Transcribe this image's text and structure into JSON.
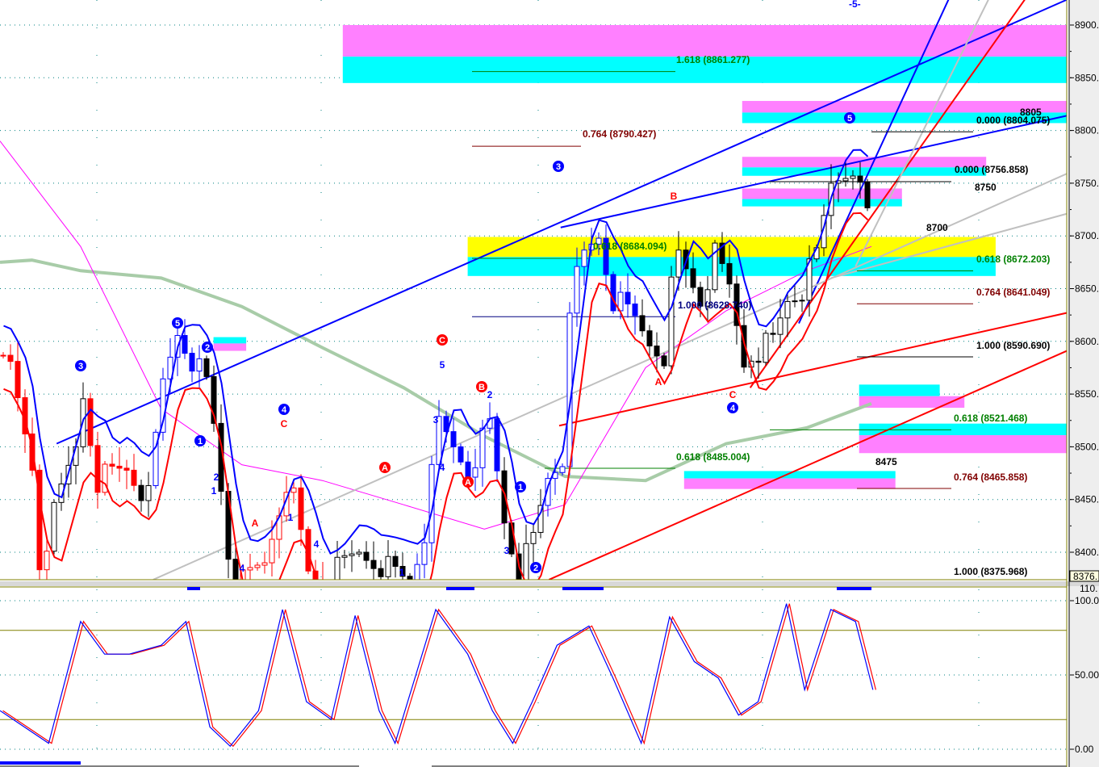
{
  "chart_data": {
    "type": "candlestick",
    "title": "",
    "top_marker": "-5-",
    "price_axis": {
      "ylim": [
        8350,
        8925
      ],
      "ticks": [
        "8900.",
        "8850.",
        "8800.",
        "8750.",
        "8700.",
        "8650.",
        "8600.",
        "8550.",
        "8500.",
        "8450.",
        "8400."
      ],
      "tick_values": [
        8900,
        8850,
        8800,
        8750,
        8700,
        8650,
        8600,
        8550,
        8500,
        8450,
        8400
      ],
      "last_price_label": "8376."
    },
    "oscillator_axis": {
      "ylim": [
        -8,
        110
      ],
      "ticks": [
        "100.0",
        "50.00",
        "0.00"
      ],
      "tick_values": [
        100,
        50,
        0
      ],
      "top_label": "110.",
      "levels": [
        80,
        20
      ]
    },
    "colors": {
      "up": "#ffffff",
      "down": "#000000",
      "blue": "#0000ff",
      "red": "#ff0000",
      "magenta": "#ff80ff",
      "cyan": "#00ffff",
      "yellow": "#ffff00",
      "ma": "#a8cca8",
      "grid": "#008080",
      "olive": "#808000"
    },
    "price_path": [
      [
        0,
        8600
      ],
      [
        4,
        8480
      ],
      [
        5,
        8390
      ],
      [
        10,
        8500
      ],
      [
        11,
        8550
      ],
      [
        13,
        8470
      ],
      [
        17,
        8480
      ],
      [
        20,
        8450
      ],
      [
        22,
        8560
      ],
      [
        24,
        8610
      ],
      [
        28,
        8560
      ],
      [
        29,
        8520
      ],
      [
        31,
        8400
      ],
      [
        33,
        8370
      ],
      [
        36,
        8390
      ],
      [
        39,
        8470
      ],
      [
        40,
        8450
      ],
      [
        42,
        8380
      ],
      [
        44,
        8370
      ],
      [
        49,
        8400
      ],
      [
        52,
        8390
      ],
      [
        56,
        8370
      ],
      [
        58,
        8420
      ],
      [
        60,
        8520
      ],
      [
        62,
        8500
      ],
      [
        64,
        8480
      ],
      [
        67,
        8520
      ],
      [
        69,
        8430
      ],
      [
        71,
        8380
      ],
      [
        73,
        8410
      ],
      [
        75,
        8470
      ],
      [
        77,
        8490
      ],
      [
        78,
        8640
      ],
      [
        80,
        8680
      ],
      [
        82,
        8700
      ],
      [
        84,
        8640
      ],
      [
        87,
        8620
      ],
      [
        89,
        8600
      ],
      [
        91,
        8590
      ],
      [
        92,
        8650
      ],
      [
        93,
        8680
      ],
      [
        96,
        8640
      ],
      [
        98,
        8680
      ],
      [
        100,
        8650
      ],
      [
        102,
        8580
      ],
      [
        103,
        8590
      ],
      [
        106,
        8600
      ],
      [
        108,
        8640
      ],
      [
        110,
        8650
      ],
      [
        112,
        8680
      ],
      [
        114,
        8750
      ],
      [
        117,
        8770
      ],
      [
        118,
        8740
      ],
      [
        119,
        8720
      ]
    ],
    "bar_color_regimes": [
      {
        "from": 0,
        "to": 6,
        "color": "red"
      },
      {
        "from": 12,
        "to": 18,
        "color": "red"
      },
      {
        "from": 21,
        "to": 27,
        "color": "blue"
      },
      {
        "from": 33,
        "to": 44,
        "color": "red"
      },
      {
        "from": 57,
        "to": 68,
        "color": "blue"
      },
      {
        "from": 75,
        "to": 87,
        "color": "blue"
      }
    ],
    "moving_average": [
      [
        0,
        8675
      ],
      [
        4.4,
        8677
      ],
      [
        11.1,
        8667
      ],
      [
        22.2,
        8660
      ],
      [
        33.3,
        8633
      ],
      [
        44.4,
        8594
      ],
      [
        55.6,
        8556
      ],
      [
        66.7,
        8510
      ],
      [
        77.8,
        8472
      ],
      [
        88.9,
        8468
      ],
      [
        100,
        8503
      ],
      [
        111.1,
        8518
      ],
      [
        120,
        8541
      ]
    ],
    "slow_average": [
      [
        0,
        8790
      ],
      [
        11.1,
        8690
      ],
      [
        22.2,
        8536
      ],
      [
        33.3,
        8483
      ],
      [
        44.4,
        8468
      ],
      [
        55.6,
        8445
      ],
      [
        66.7,
        8422
      ],
      [
        77.8,
        8445
      ],
      [
        88.9,
        8575
      ],
      [
        100,
        8629
      ],
      [
        111.1,
        8667
      ],
      [
        120,
        8690
      ]
    ],
    "zones": [
      {
        "from_bar": 47.2,
        "to_bar": 146.9,
        "low": 8870,
        "high": 8900,
        "color": "magenta"
      },
      {
        "from_bar": 47.2,
        "to_bar": 146.9,
        "low": 8845,
        "high": 8870,
        "color": "cyan"
      },
      {
        "from_bar": 102.2,
        "to_bar": 146.9,
        "low": 8817,
        "high": 8828,
        "color": "magenta"
      },
      {
        "from_bar": 102.2,
        "to_bar": 146.9,
        "low": 8807,
        "high": 8817,
        "color": "cyan"
      },
      {
        "from_bar": 102.2,
        "to_bar": 135.8,
        "low": 8765,
        "high": 8775,
        "color": "magenta"
      },
      {
        "from_bar": 102.2,
        "to_bar": 135.8,
        "low": 8757,
        "high": 8765,
        "color": "cyan"
      },
      {
        "from_bar": 102.2,
        "to_bar": 124.2,
        "low": 8735,
        "high": 8745,
        "color": "magenta"
      },
      {
        "from_bar": 102.2,
        "to_bar": 124.2,
        "low": 8728,
        "high": 8735,
        "color": "cyan"
      },
      {
        "from_bar": 64.4,
        "to_bar": 137.1,
        "low": 8680,
        "high": 8699,
        "color": "yellow"
      },
      {
        "from_bar": 64.4,
        "to_bar": 137.1,
        "low": 8662,
        "high": 8680,
        "color": "cyan"
      },
      {
        "from_bar": 29.4,
        "to_bar": 33.9,
        "low": 8598,
        "high": 8604,
        "color": "cyan"
      },
      {
        "from_bar": 29.4,
        "to_bar": 33.9,
        "low": 8591,
        "high": 8598,
        "color": "magenta"
      },
      {
        "from_bar": 118.3,
        "to_bar": 129.4,
        "low": 8548,
        "high": 8559,
        "color": "cyan"
      },
      {
        "from_bar": 118.3,
        "to_bar": 132.8,
        "low": 8537,
        "high": 8548,
        "color": "magenta"
      },
      {
        "from_bar": 118.3,
        "to_bar": 146.9,
        "low": 8511,
        "high": 8522,
        "color": "cyan"
      },
      {
        "from_bar": 118.3,
        "to_bar": 146.9,
        "low": 8494,
        "high": 8511,
        "color": "magenta"
      },
      {
        "from_bar": 94.2,
        "to_bar": 123.3,
        "low": 8470,
        "high": 8477,
        "color": "cyan"
      },
      {
        "from_bar": 94.2,
        "to_bar": 123.3,
        "low": 8460,
        "high": 8470,
        "color": "magenta"
      }
    ],
    "trendlines": [
      {
        "p1": [
          7.8,
          8503
        ],
        "p2": [
          146.9,
          8924
        ],
        "color": "blue"
      },
      {
        "p1": [
          77.2,
          8708
        ],
        "p2": [
          146.9,
          8814
        ],
        "color": "blue"
      },
      {
        "p1": [
          110,
          8617
        ],
        "p2": [
          130.6,
          8924
        ],
        "color": "blue"
      },
      {
        "p1": [
          75.6,
          8374
        ],
        "p2": [
          146.9,
          8591
        ],
        "color": "red"
      },
      {
        "p1": [
          77,
          8520
        ],
        "p2": [
          146.9,
          8627
        ],
        "color": "red"
      },
      {
        "p1": [
          103.3,
          8556
        ],
        "p2": [
          141.1,
          8924
        ],
        "color": "red"
      },
      {
        "p1": [
          21.1,
          8374
        ],
        "p2": [
          146.9,
          8759
        ],
        "color": "gray"
      },
      {
        "p1": [
          114.4,
          8660
        ],
        "p2": [
          146.9,
          8721
        ],
        "color": "gray"
      },
      {
        "p1": [
          117.8,
          8671
        ],
        "p2": [
          136.1,
          8924
        ],
        "color": "gray"
      }
    ],
    "fib_levels": [
      {
        "label": "1.618 (8861.277)",
        "price": 8861.277,
        "from_bar": 65,
        "to_bar": 93,
        "color": "#008000"
      },
      {
        "label": "0.764 (8790.427)",
        "price": 8790.427,
        "from_bar": 65,
        "to_bar": 80,
        "color": "#800000"
      },
      {
        "label": "0.000 (8804.075)",
        "price": 8804.075,
        "from_bar": 120,
        "to_bar": 134,
        "color": "#000000"
      },
      {
        "label": "0.000 (8756.858)",
        "price": 8756.858,
        "from_bar": 106,
        "to_bar": 131,
        "color": "#000000"
      },
      {
        "label": "0.618 (8684.094)",
        "price": 8684.094,
        "from_bar": 65,
        "to_bar": 81,
        "color": "#008000"
      },
      {
        "label": "0.618 (8672.203)",
        "price": 8672.203,
        "from_bar": 118,
        "to_bar": 134,
        "color": "#008000"
      },
      {
        "label": "1.000 (8628.740)",
        "price": 8628.74,
        "from_bar": 65,
        "to_bar": 93,
        "color": "#000080"
      },
      {
        "label": "0.764 (8641.049)",
        "price": 8641.049,
        "from_bar": 118,
        "to_bar": 134,
        "color": "#800000"
      },
      {
        "label": "1.000 (8590.690)",
        "price": 8590.69,
        "from_bar": 118,
        "to_bar": 134,
        "color": "#000000"
      },
      {
        "label": "0.618 (8521.468)",
        "price": 8521.468,
        "from_bar": 106,
        "to_bar": 131,
        "color": "#008000"
      },
      {
        "label": "0.618 (8485.004)",
        "price": 8485.004,
        "from_bar": 75,
        "to_bar": 93,
        "color": "#008000"
      },
      {
        "label": "0.764 (8465.858)",
        "price": 8465.858,
        "from_bar": 118,
        "to_bar": 131,
        "color": "#800000"
      },
      {
        "label": "1.000 (8375.968)",
        "price": 8375.968,
        "from_bar": 118,
        "to_bar": 131,
        "color": "#000000"
      }
    ],
    "price_targets": [
      "8805",
      "8750",
      "8700",
      "8475"
    ],
    "wave_labels_circled_blue": [
      "3",
      "5",
      "2",
      "1",
      "4",
      "3",
      "5",
      "4",
      "1",
      "2"
    ],
    "wave_labels_circled_red": [
      "C",
      "A",
      "B",
      "A"
    ],
    "wave_labels_red": [
      "A",
      "C",
      "B",
      "A",
      "C"
    ],
    "wave_labels_blue": [
      "5",
      "3",
      "4",
      "2",
      "3",
      "2",
      "1",
      "1",
      "4",
      "4",
      "1"
    ],
    "stochastic": [
      [
        0,
        26
      ],
      [
        6.7,
        4
      ],
      [
        11.1,
        86
      ],
      [
        14.4,
        64
      ],
      [
        17.8,
        64
      ],
      [
        22.2,
        70
      ],
      [
        25.6,
        86
      ],
      [
        28.9,
        15
      ],
      [
        31.7,
        2
      ],
      [
        35.6,
        26
      ],
      [
        38.9,
        94
      ],
      [
        42.2,
        32
      ],
      [
        45.6,
        20
      ],
      [
        48.9,
        90
      ],
      [
        52.2,
        26
      ],
      [
        54.4,
        4
      ],
      [
        60,
        94
      ],
      [
        64.4,
        64
      ],
      [
        67.8,
        26
      ],
      [
        70.6,
        4
      ],
      [
        73.3,
        32
      ],
      [
        76.7,
        70
      ],
      [
        81.1,
        83
      ],
      [
        84.4,
        48
      ],
      [
        88.3,
        4
      ],
      [
        92.2,
        89
      ],
      [
        95.6,
        59
      ],
      [
        98.9,
        48
      ],
      [
        101.7,
        23
      ],
      [
        104.4,
        32
      ],
      [
        108.3,
        98
      ],
      [
        110.8,
        40
      ],
      [
        114.4,
        94
      ],
      [
        117.8,
        86
      ],
      [
        120.2,
        40
      ]
    ]
  }
}
